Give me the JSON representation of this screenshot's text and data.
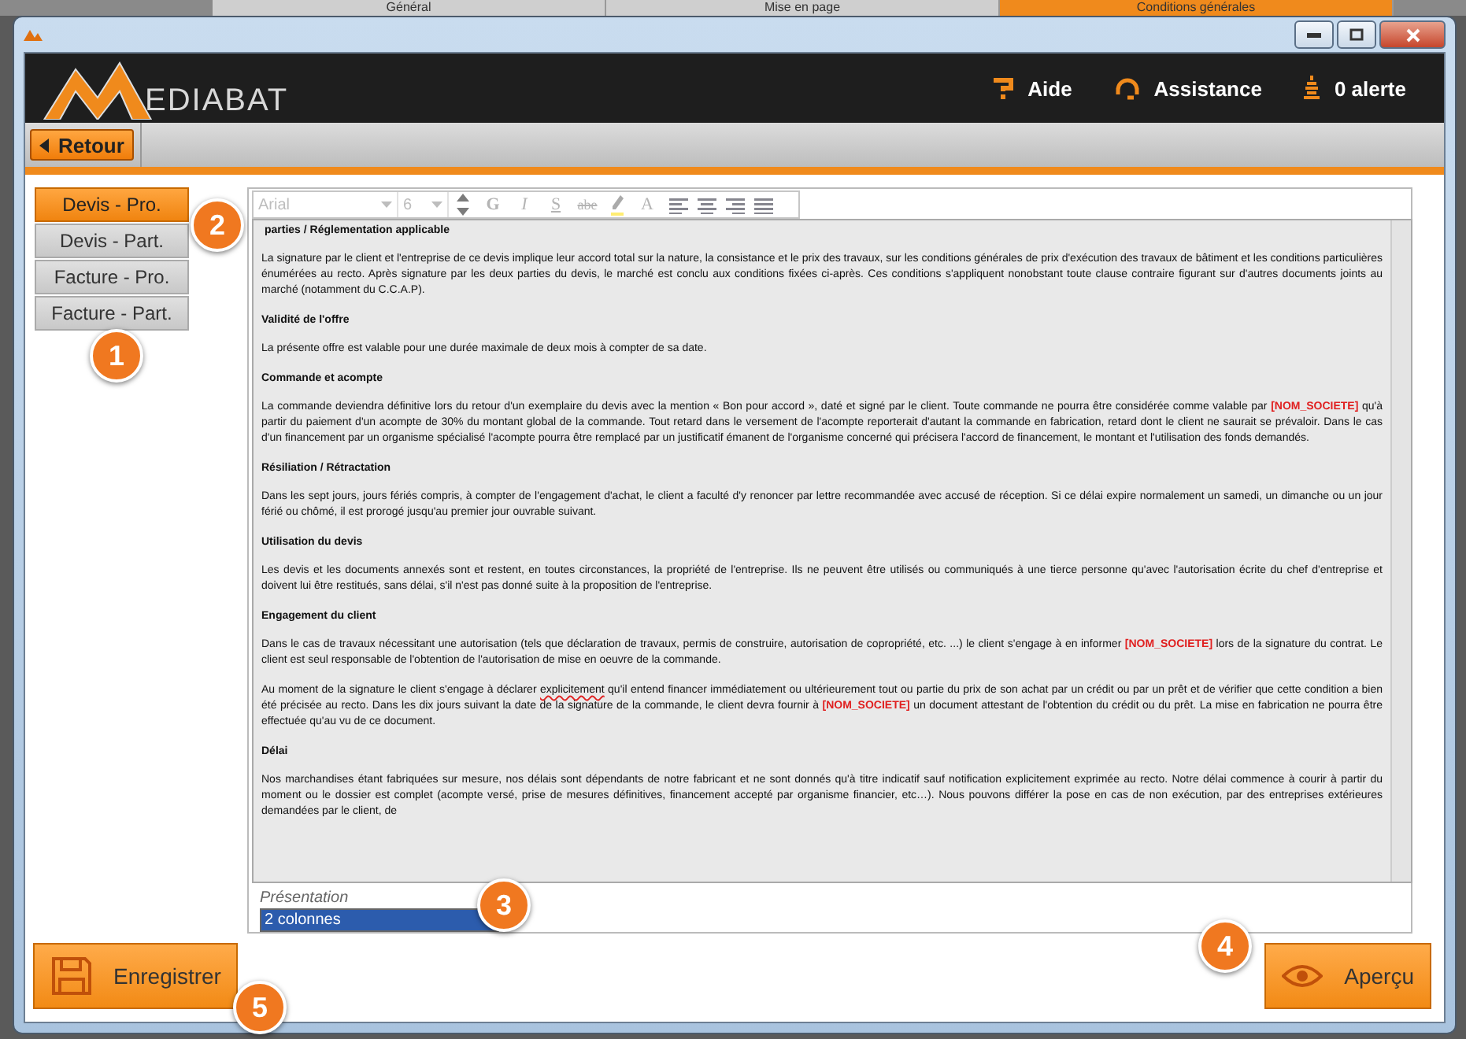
{
  "background_tabs": [
    {
      "label": "Général",
      "selected": false
    },
    {
      "label": "Mise en page",
      "selected": false
    },
    {
      "label": "Conditions générales",
      "selected": true
    }
  ],
  "header": {
    "logo": "EDIABAT",
    "links": [
      {
        "kind": "help",
        "label": "Aide"
      },
      {
        "kind": "support",
        "label": "Assistance"
      },
      {
        "kind": "alert",
        "label": "0 alerte"
      }
    ]
  },
  "toolbar": {
    "back": "Retour"
  },
  "sidebar": {
    "items": [
      {
        "label": "Devis - Pro.",
        "selected": true
      },
      {
        "label": "Devis - Part.",
        "selected": false
      },
      {
        "label": "Facture - Pro.",
        "selected": false
      },
      {
        "label": "Facture - Part.",
        "selected": false
      }
    ]
  },
  "editor": {
    "disabled": true,
    "font": "Arial",
    "size": "6",
    "buttons": [
      {
        "kind": "bold",
        "label": "G"
      },
      {
        "kind": "italic",
        "label": "I"
      },
      {
        "kind": "underline",
        "label": "S"
      },
      {
        "kind": "strike",
        "label": "abe"
      },
      {
        "kind": "pen"
      },
      {
        "kind": "plain",
        "label": "A"
      },
      {
        "kind": "align-left"
      },
      {
        "kind": "align-center"
      },
      {
        "kind": "align-right"
      },
      {
        "kind": "justify"
      }
    ],
    "blocks": [
      {
        "kind": "heading",
        "text": "parties / Réglementation applicable"
      },
      {
        "kind": "paragraph",
        "segments": [
          {
            "kind": "plain",
            "text": "La signature par le client et l'entreprise de ce devis implique leur accord total sur la nature, la consistance et le prix des travaux, sur les conditions générales de prix d'exécution des travaux de bâtiment et les conditions particulières énumérées au recto. Après signature par les deux parties du devis, le marché est conclu aux conditions fixées ci-après. Ces conditions s'appliquent nonobstant toute clause contraire figurant sur d'autres documents joints au marché (notamment du C.C.A.P)."
          }
        ]
      },
      {
        "kind": "heading",
        "text": "Validité de l'offre"
      },
      {
        "kind": "paragraph",
        "segments": [
          {
            "kind": "plain",
            "text": "La présente offre est valable pour une durée maximale de deux mois à compter de sa date."
          }
        ]
      },
      {
        "kind": "heading",
        "text": "Commande et acompte"
      },
      {
        "kind": "paragraph",
        "segments": [
          {
            "kind": "plain",
            "text": "La commande deviendra définitive lors du retour d'un exemplaire du devis avec la mention « Bon pour accord », daté et signé par le client. Toute commande ne pourra être considérée comme valable par "
          },
          {
            "kind": "field",
            "text": "[NOM_SOCIETE]"
          },
          {
            "kind": "plain",
            "text": " qu'à partir du paiement d'un acompte de 30% du montant global de la commande. Tout retard dans le versement de l'acompte reporterait d'autant la commande en fabrication, retard dont le client ne saurait se prévaloir. Dans le cas d'un financement par un organisme spécialisé l'acompte pourra être remplacé par un justificatif émanent de l'organisme concerné qui précisera l'accord de financement, le montant et l'utilisation des fonds demandés."
          }
        ]
      },
      {
        "kind": "heading",
        "text": "Résiliation / Rétractation"
      },
      {
        "kind": "paragraph",
        "segments": [
          {
            "kind": "plain",
            "text": "Dans les sept jours, jours fériés compris, à compter de l'engagement d'achat, le client a faculté d'y renoncer par lettre recommandée avec accusé de réception. Si ce délai expire normalement un samedi, un dimanche ou un jour férié ou chômé, il est prorogé jusqu'au premier jour ouvrable suivant."
          }
        ]
      },
      {
        "kind": "heading",
        "text": "Utilisation du devis"
      },
      {
        "kind": "paragraph",
        "segments": [
          {
            "kind": "plain",
            "text": "Les devis et les documents annexés sont et restent, en toutes circonstances, la propriété de l'entreprise. Ils ne peuvent être utilisés ou communiqués à une tierce personne qu'avec l'autorisation écrite du chef d'entreprise et doivent lui être restitués, sans délai, s'il n'est pas donné suite à la proposition de l'entreprise."
          }
        ]
      },
      {
        "kind": "heading",
        "text": "Engagement du client"
      },
      {
        "kind": "paragraph",
        "segments": [
          {
            "kind": "plain",
            "text": "Dans le cas de travaux nécessitant une autorisation (tels que déclaration de travaux, permis de construire, autorisation de copropriété, etc. ...) le client s'engage à en informer "
          },
          {
            "kind": "field",
            "text": "[NOM_SOCIETE]"
          },
          {
            "kind": "plain",
            "text": "  lors de la signature du contrat. Le client est seul responsable de l'obtention de l'autorisation de mise en oeuvre de la commande."
          }
        ]
      },
      {
        "kind": "paragraph",
        "segments": [
          {
            "kind": "plain",
            "text": "Au moment de la signature le client s'engage à déclarer "
          },
          {
            "kind": "misspelled",
            "text": "explicitement"
          },
          {
            "kind": "plain",
            "text": " qu'il entend financer immédiatement ou ultérieurement tout ou partie du prix de son achat par un crédit ou par un prêt et de vérifier que cette condition a bien été précisée au recto. Dans les dix jours suivant la date de la signature de la commande, le client devra fournir à "
          },
          {
            "kind": "field",
            "text": "[NOM_SOCIETE]"
          },
          {
            "kind": "plain",
            "text": " un document attestant de l'obtention du crédit ou du prêt. La mise en fabrication ne pourra être effectuée qu'au vu de ce document."
          }
        ]
      },
      {
        "kind": "heading",
        "text": "Délai"
      },
      {
        "kind": "paragraph",
        "segments": [
          {
            "kind": "plain",
            "text": "Nos marchandises étant fabriquées sur mesure, nos délais sont dépendants de notre fabricant et ne sont donnés qu'à titre indicatif sauf notification explicitement exprimée au recto. Notre délai commence à courir à partir du moment ou le dossier est complet (acompte versé, prise de mesures définitives, financement accepté par organisme financier, etc…). Nous pouvons différer la pose en cas de non exécution, par des entreprises extérieures demandées par le client, de"
          }
        ]
      }
    ]
  },
  "presentation": {
    "label": "Présentation",
    "value": "2 colonnes"
  },
  "actions": {
    "save": "Enregistrer",
    "preview": "Aperçu"
  },
  "callouts": [
    "1",
    "2",
    "3",
    "4",
    "5"
  ]
}
